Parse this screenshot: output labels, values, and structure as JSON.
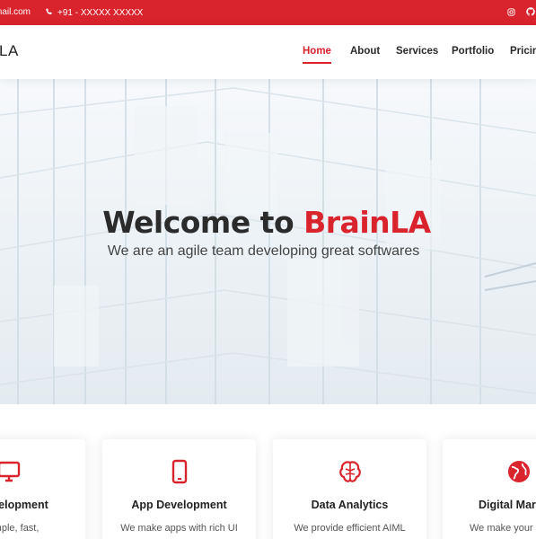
{
  "topbar": {
    "email": "mail.com",
    "phone": "+91 - XXXXX XXXXX",
    "social": [
      "instagram-icon",
      "github-icon"
    ],
    "accent": "#d9232d"
  },
  "header": {
    "logo": "LA",
    "nav": [
      {
        "label": "Home",
        "active": true
      },
      {
        "label": "About",
        "active": false
      },
      {
        "label": "Services",
        "active": false
      },
      {
        "label": "Portfolio",
        "active": false
      },
      {
        "label": "Pricing",
        "active": false
      }
    ]
  },
  "hero": {
    "title_prefix": "Welcome to ",
    "title_brand": "BrainLA",
    "subtitle": "We are an agile team developing great softwares"
  },
  "services": [
    {
      "icon": "monitor-icon",
      "title": "Development",
      "desc": "e simple, fast,"
    },
    {
      "icon": "mobile-icon",
      "title": "App Development",
      "desc": "We make apps with rich UI"
    },
    {
      "icon": "brain-icon",
      "title": "Data Analytics",
      "desc": "We provide efficient AIML"
    },
    {
      "icon": "globe-icon",
      "title": "Digital Mark",
      "desc": "We make your b"
    }
  ]
}
